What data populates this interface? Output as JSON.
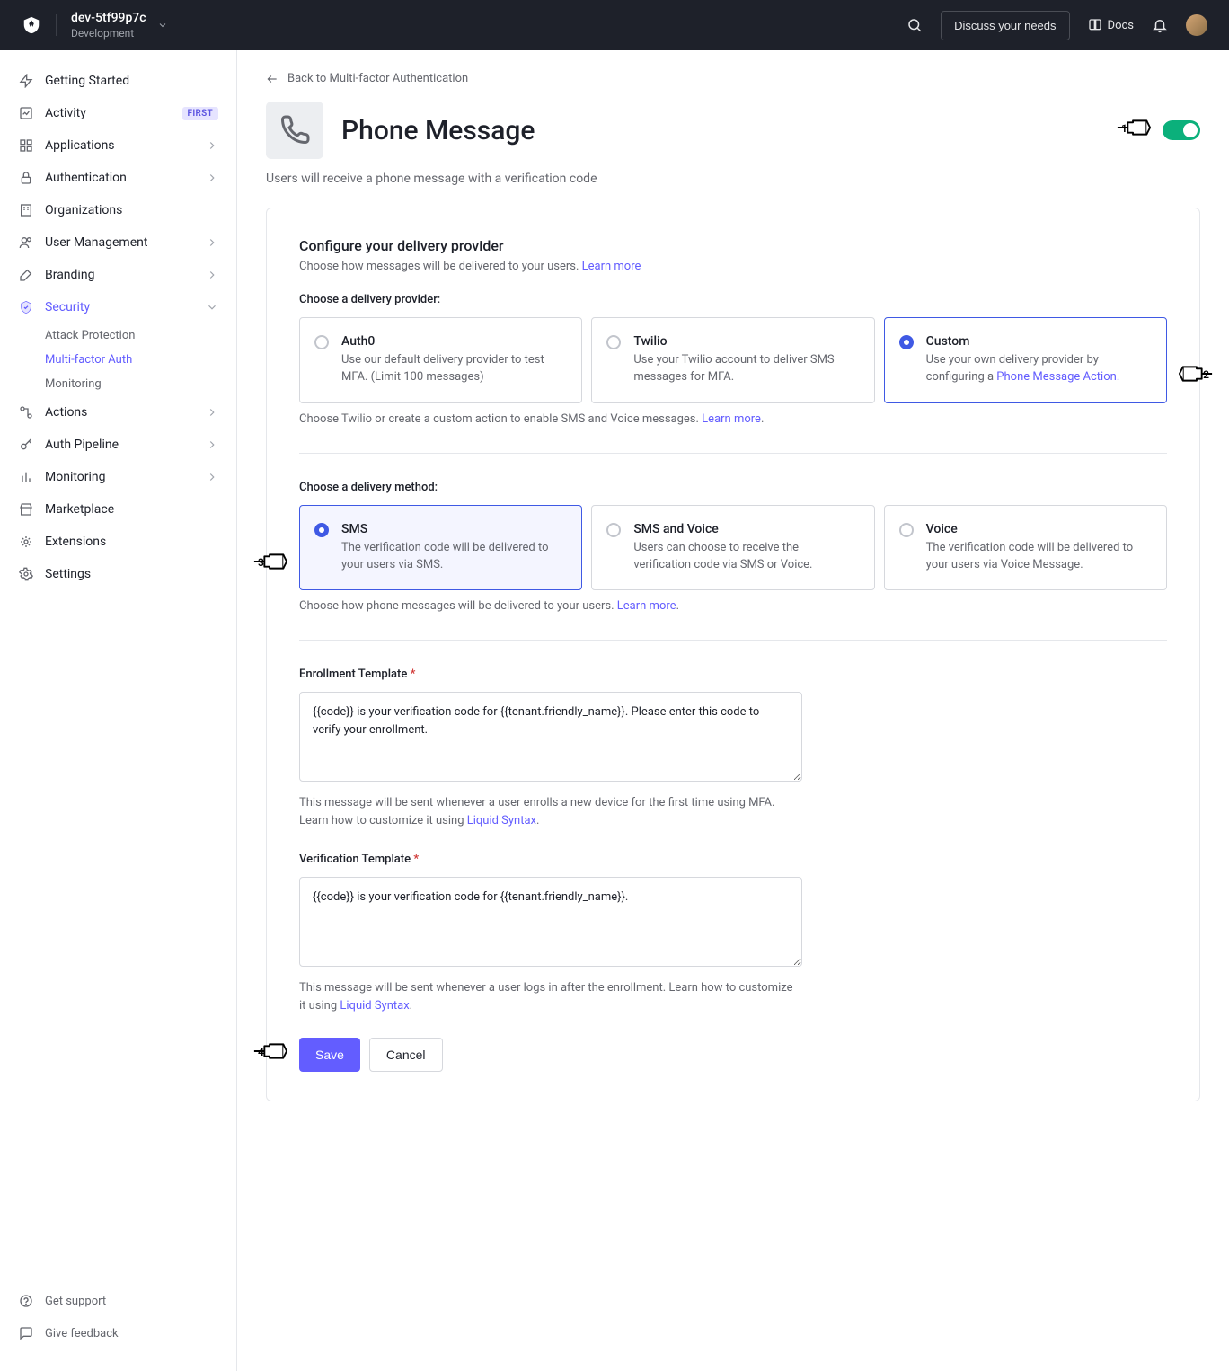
{
  "topbar": {
    "tenant_name": "dev-5tf99p7c",
    "tenant_env": "Development",
    "discuss_btn": "Discuss your needs",
    "docs_label": "Docs"
  },
  "sidebar": {
    "items": [
      {
        "label": "Getting Started"
      },
      {
        "label": "Activity",
        "badge": "FIRST"
      },
      {
        "label": "Applications",
        "caret": true
      },
      {
        "label": "Authentication",
        "caret": true
      },
      {
        "label": "Organizations"
      },
      {
        "label": "User Management",
        "caret": true
      },
      {
        "label": "Branding",
        "caret": true
      },
      {
        "label": "Security",
        "active": true,
        "caret": true
      },
      {
        "label": "Actions",
        "caret": true
      },
      {
        "label": "Auth Pipeline",
        "caret": true
      },
      {
        "label": "Monitoring",
        "caret": true
      },
      {
        "label": "Marketplace"
      },
      {
        "label": "Extensions"
      },
      {
        "label": "Settings"
      }
    ],
    "security_sub": [
      {
        "label": "Attack Protection"
      },
      {
        "label": "Multi-factor Auth",
        "active": true
      },
      {
        "label": "Monitoring"
      }
    ],
    "bottom": [
      {
        "label": "Get support"
      },
      {
        "label": "Give feedback"
      }
    ]
  },
  "page": {
    "back_label": "Back to Multi-factor Authentication",
    "title": "Phone Message",
    "subtitle": "Users will receive a phone message with a verification code"
  },
  "provider": {
    "title": "Configure your delivery provider",
    "sub_prefix": "Choose how messages will be delivered to your users. ",
    "learn_more": "Learn more",
    "choose_label": "Choose a delivery provider:",
    "options": [
      {
        "title": "Auth0",
        "desc": "Use our default delivery provider to test MFA. (Limit 100 messages)"
      },
      {
        "title": "Twilio",
        "desc": "Use your Twilio account to deliver SMS messages for MFA."
      },
      {
        "title": "Custom",
        "desc_prefix": "Use your own delivery provider by configuring a ",
        "desc_link": "Phone Message Action."
      }
    ],
    "hint_prefix": "Choose Twilio or create a custom action to enable SMS and Voice messages. ",
    "hint_link": "Learn more",
    "hint_suffix": "."
  },
  "method": {
    "label": "Choose a delivery method:",
    "options": [
      {
        "title": "SMS",
        "desc": "The verification code will be delivered to your users via SMS."
      },
      {
        "title": "SMS and Voice",
        "desc": "Users can choose to receive the verification code via SMS or Voice."
      },
      {
        "title": "Voice",
        "desc": "The verification code will be delivered to your users via Voice Message."
      }
    ],
    "hint_prefix": "Choose how phone messages will be delivered to your users. ",
    "hint_link": "Learn more",
    "hint_suffix": "."
  },
  "enroll": {
    "label": "Enrollment Template",
    "value": "{{code}} is your verification code for {{tenant.friendly_name}}. Please enter this code to verify your enrollment.",
    "hint_prefix": "This message will be sent whenever a user enrolls a new device for the first time using MFA. Learn how to customize it using ",
    "hint_link": "Liquid Syntax",
    "hint_suffix": "."
  },
  "verify": {
    "label": "Verification Template",
    "value": "{{code}} is your verification code for {{tenant.friendly_name}}.",
    "hint_prefix": "This message will be sent whenever a user logs in after the enrollment. Learn how to customize it using ",
    "hint_link": "Liquid Syntax",
    "hint_suffix": "."
  },
  "buttons": {
    "save": "Save",
    "cancel": "Cancel"
  }
}
